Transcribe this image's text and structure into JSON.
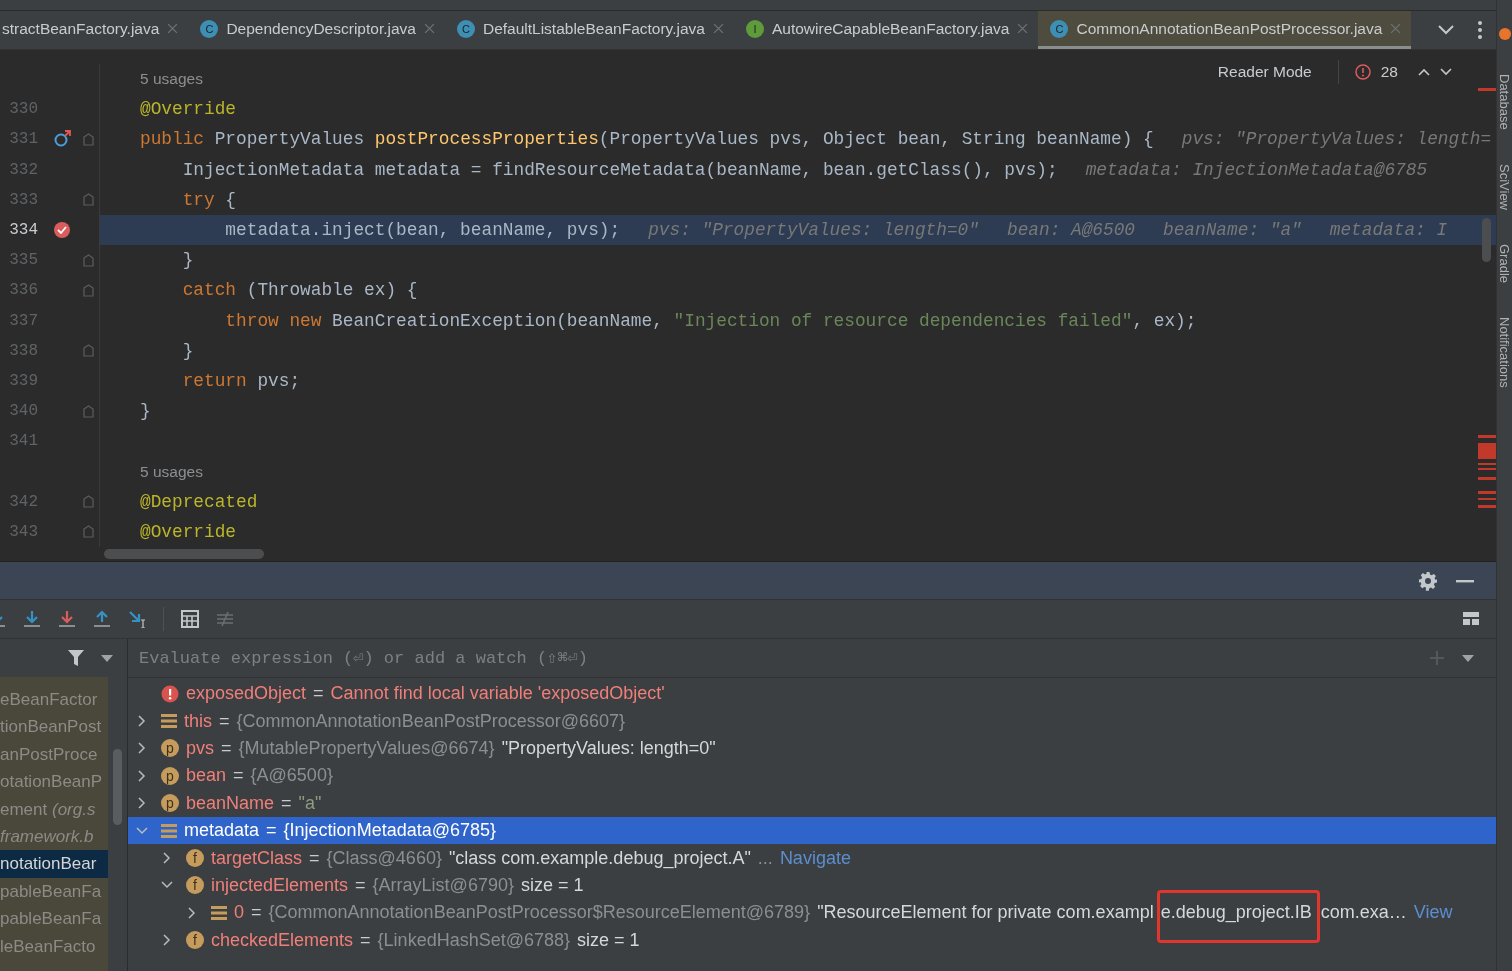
{
  "tabs": [
    {
      "label": "stractBeanFactory.java",
      "selected": false
    },
    {
      "label": "DependencyDescriptor.java",
      "icon_letter": "C",
      "color": "#3d8fb3",
      "selected": false
    },
    {
      "label": "DefaultListableBeanFactory.java",
      "icon_letter": "C",
      "color": "#3d8fb3",
      "selected": false
    },
    {
      "label": "AutowireCapableBeanFactory.java",
      "icon_letter": "I",
      "color": "#5e9b3a",
      "selected": false
    },
    {
      "label": "CommonAnnotationBeanPostProcessor.java",
      "icon_letter": "C",
      "color": "#3d8fb3",
      "selected": true
    }
  ],
  "editor": {
    "reader_mode": "Reader Mode",
    "problem_count": "28",
    "rows": [
      {
        "kind": "usages",
        "text": "5 usages"
      },
      {
        "kind": "code",
        "number": "330",
        "overrides": false,
        "breakpoint": false,
        "fold": false,
        "current": false,
        "tokens": [
          {
            "kind": "ann",
            "text": "@Override"
          }
        ]
      },
      {
        "kind": "code",
        "number": "331",
        "overrides": true,
        "breakpoint": false,
        "fold": true,
        "current": false,
        "tokens": [
          {
            "kind": "kw",
            "text": "public"
          },
          {
            "kind": "plain",
            "text": " PropertyValues "
          },
          {
            "kind": "fn",
            "text": "postProcessProperties"
          },
          {
            "kind": "plain",
            "text": "(PropertyValues pvs, Object bean, String beanName) {"
          },
          {
            "kind": "hint",
            "text": "pvs: \"PropertyValues: length="
          }
        ]
      },
      {
        "kind": "code",
        "number": "332",
        "overrides": false,
        "breakpoint": false,
        "fold": false,
        "current": false,
        "tokens": [
          {
            "kind": "plain",
            "text": "    InjectionMetadata metadata = findResourceMetadata(beanName, bean.getClass(), pvs);"
          },
          {
            "kind": "hint",
            "text": "metadata: InjectionMetadata@6785"
          }
        ]
      },
      {
        "kind": "code",
        "number": "333",
        "overrides": false,
        "breakpoint": false,
        "fold": true,
        "current": false,
        "tokens": [
          {
            "kind": "kw",
            "text": "    try"
          },
          {
            "kind": "plain",
            "text": " {"
          }
        ]
      },
      {
        "kind": "code",
        "number": "334",
        "overrides": false,
        "breakpoint": true,
        "fold": false,
        "current": true,
        "tokens": [
          {
            "kind": "plain",
            "text": "        metadata.inject(bean, beanName, pvs);"
          },
          {
            "kind": "hint",
            "text": "pvs: \"PropertyValues: length=0\""
          },
          {
            "kind": "hint",
            "text": "bean: A@6500"
          },
          {
            "kind": "hint",
            "text": "beanName: \"a\""
          },
          {
            "kind": "hint",
            "text": "metadata: I"
          }
        ]
      },
      {
        "kind": "code",
        "number": "335",
        "overrides": false,
        "breakpoint": false,
        "fold": true,
        "current": false,
        "tokens": [
          {
            "kind": "plain",
            "text": "    }"
          }
        ]
      },
      {
        "kind": "code",
        "number": "336",
        "overrides": false,
        "breakpoint": false,
        "fold": true,
        "current": false,
        "tokens": [
          {
            "kind": "kw",
            "text": "    catch"
          },
          {
            "kind": "plain",
            "text": " (Throwable ex) {"
          }
        ]
      },
      {
        "kind": "code",
        "number": "337",
        "overrides": false,
        "breakpoint": false,
        "fold": false,
        "current": false,
        "tokens": [
          {
            "kind": "kw",
            "text": "        throw new"
          },
          {
            "kind": "plain",
            "text": " BeanCreationException(beanName, "
          },
          {
            "kind": "str",
            "text": "\"Injection of resource dependencies failed\""
          },
          {
            "kind": "plain",
            "text": ", ex);"
          }
        ]
      },
      {
        "kind": "code",
        "number": "338",
        "overrides": false,
        "breakpoint": false,
        "fold": true,
        "current": false,
        "tokens": [
          {
            "kind": "plain",
            "text": "    }"
          }
        ]
      },
      {
        "kind": "code",
        "number": "339",
        "overrides": false,
        "breakpoint": false,
        "fold": false,
        "current": false,
        "tokens": [
          {
            "kind": "kw",
            "text": "    return"
          },
          {
            "kind": "plain",
            "text": " pvs;"
          }
        ]
      },
      {
        "kind": "code",
        "number": "340",
        "overrides": false,
        "breakpoint": false,
        "fold": true,
        "current": false,
        "tokens": [
          {
            "kind": "plain",
            "text": "}"
          }
        ]
      },
      {
        "kind": "code",
        "number": "341",
        "overrides": false,
        "breakpoint": false,
        "fold": false,
        "current": false
      },
      {
        "kind": "usages",
        "text": "5 usages"
      },
      {
        "kind": "code",
        "number": "342",
        "overrides": false,
        "breakpoint": false,
        "fold": true,
        "current": false,
        "tokens": [
          {
            "kind": "ann",
            "text": "@Deprecated"
          }
        ]
      },
      {
        "kind": "code",
        "number": "343",
        "overrides": false,
        "breakpoint": false,
        "fold": true,
        "current": false,
        "tokens": [
          {
            "kind": "ann",
            "text": "@Override"
          }
        ]
      }
    ]
  },
  "side_tools": [
    "Database",
    "SciView",
    "Gradle",
    "Notifications"
  ],
  "debugger": {
    "watch_placeholder": "Evaluate expression (⏎) or add a watch (⇧⌘⏎)",
    "frames": [
      {
        "text": "eBeanFactor",
        "italic": false,
        "selected": false
      },
      {
        "text": "tionBeanPost",
        "italic": false,
        "selected": false
      },
      {
        "text": "anPostProce",
        "italic": false,
        "selected": false
      },
      {
        "text": "otationBeanP",
        "italic": false,
        "selected": false
      },
      {
        "text": "ement *(org.s*",
        "italic": false,
        "selected": false
      },
      {
        "text": "framework.b",
        "italic": true,
        "selected": false
      },
      {
        "text": "notationBear",
        "italic": false,
        "selected": true
      },
      {
        "text": "pableBeanFa",
        "italic": false,
        "selected": false
      },
      {
        "text": "pableBeanFa",
        "italic": false,
        "selected": false
      },
      {
        "text": "leBeanFacto",
        "italic": false,
        "selected": false
      }
    ],
    "variables": [
      {
        "kind": "error",
        "name": "exposedObject",
        "selected": false,
        "parts": [
          {
            "kind": "op",
            "text": "="
          },
          {
            "kind": "error",
            "text": "Cannot find local variable 'exposedObject'"
          }
        ]
      },
      {
        "kind": "object",
        "name": "this",
        "expanded": false,
        "selected": false,
        "parts": [
          {
            "kind": "op",
            "text": "="
          },
          {
            "kind": "ref",
            "text": "{CommonAnnotationBeanPostProcessor@6607}"
          }
        ]
      },
      {
        "kind": "letter",
        "icon_letter": "p",
        "name": "pvs",
        "expanded": false,
        "selected": false,
        "parts": [
          {
            "kind": "op",
            "text": "="
          },
          {
            "kind": "ref",
            "text": "{MutablePropertyValues@6674}"
          },
          {
            "kind": "value",
            "text": "\"PropertyValues: length=0\""
          }
        ]
      },
      {
        "kind": "letter",
        "icon_letter": "p",
        "name": "bean",
        "expanded": false,
        "selected": false,
        "parts": [
          {
            "kind": "op",
            "text": "="
          },
          {
            "kind": "ref",
            "text": "{A@6500}"
          }
        ]
      },
      {
        "kind": "letter",
        "icon_letter": "p",
        "name": "beanName",
        "expanded": false,
        "selected": false,
        "parts": [
          {
            "kind": "op",
            "text": "="
          },
          {
            "kind": "str",
            "text": "\"a\""
          }
        ]
      },
      {
        "kind": "object",
        "name": "metadata",
        "expanded": true,
        "selected": true,
        "parts": [
          {
            "kind": "op",
            "text": "="
          },
          {
            "kind": "ref",
            "text": "{InjectionMetadata@6785}"
          }
        ],
        "children": [
          {
            "kind": "letter",
            "icon_letter": "f",
            "name": "targetClass",
            "expanded": false,
            "selected": false,
            "parts": [
              {
                "kind": "op",
                "text": "="
              },
              {
                "kind": "ref",
                "text": "{Class@4660}"
              },
              {
                "kind": "value",
                "text": "\"class com.example.debug_project.A\""
              },
              {
                "kind": "ref",
                "text": "..."
              },
              {
                "kind": "link",
                "text": "Navigate"
              }
            ]
          },
          {
            "kind": "letter",
            "icon_letter": "f",
            "name": "injectedElements",
            "expanded": true,
            "selected": false,
            "parts": [
              {
                "kind": "op",
                "text": "="
              },
              {
                "kind": "ref",
                "text": "{ArrayList@6790}"
              },
              {
                "kind": "value",
                "text": "size = 1"
              }
            ],
            "children": [
              {
                "kind": "object",
                "name": "0",
                "expanded": false,
                "selected": false,
                "parts": [
                  {
                    "kind": "op",
                    "text": "="
                  },
                  {
                    "kind": "ref",
                    "text": "{CommonAnnotationBeanPostProcessor$ResourceElement@6789}"
                  },
                  {
                    "kind": "value",
                    "text": "\"ResourceElement for private com.exampl"
                  },
                  {
                    "kind": "highlight",
                    "text": "e.debug_project.IB"
                  },
                  {
                    "kind": "value",
                    "text": "com.exa…"
                  },
                  {
                    "kind": "link",
                    "text": "View"
                  }
                ]
              }
            ]
          },
          {
            "kind": "letter",
            "icon_letter": "f",
            "name": "checkedElements",
            "expanded": false,
            "selected": false,
            "parts": [
              {
                "kind": "op",
                "text": "="
              },
              {
                "kind": "ref",
                "text": "{LinkedHashSet@6788}"
              },
              {
                "kind": "value",
                "text": "size = 1"
              }
            ]
          }
        ]
      }
    ]
  }
}
